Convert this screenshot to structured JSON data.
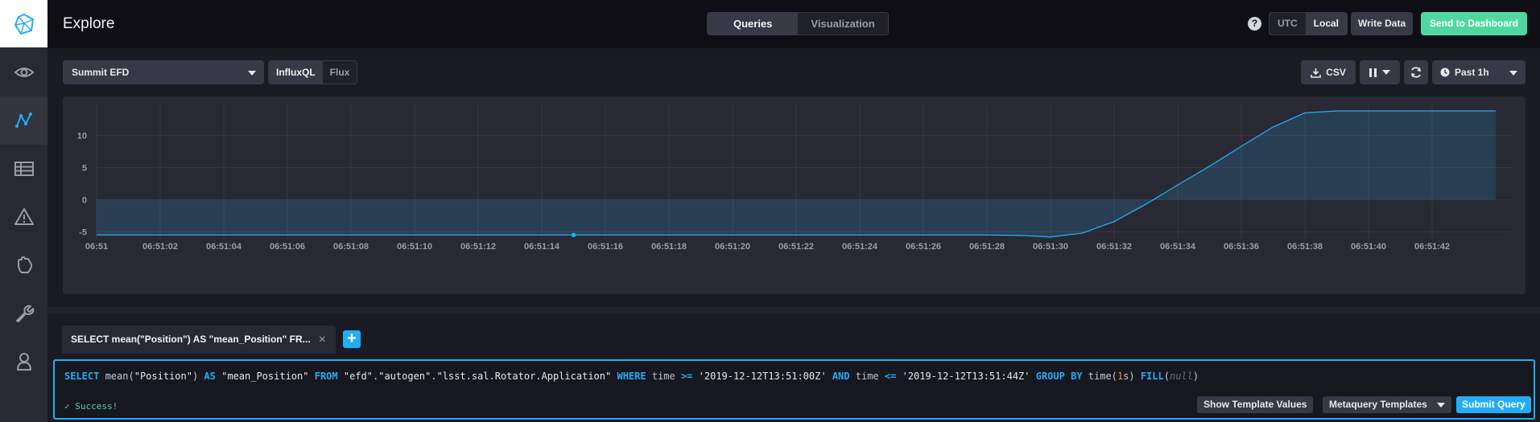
{
  "header": {
    "title": "Explore",
    "mode_tabs": [
      {
        "label": "Queries",
        "active": true
      },
      {
        "label": "Visualization",
        "active": false
      }
    ],
    "help_glyph": "?",
    "timezone": [
      {
        "label": "UTC",
        "active": false
      },
      {
        "label": "Local",
        "active": true
      }
    ],
    "write_data_label": "Write Data",
    "send_dashboard_label": "Send to Dashboard"
  },
  "nav": {
    "items": [
      {
        "icon": "logo-icon"
      },
      {
        "icon": "eye-icon"
      },
      {
        "icon": "graph-icon",
        "active": true
      },
      {
        "icon": "table-icon"
      },
      {
        "icon": "alert-icon"
      },
      {
        "icon": "hand-icon"
      },
      {
        "icon": "wrench-icon"
      },
      {
        "icon": "user-icon"
      }
    ]
  },
  "toolbar": {
    "database": "Summit EFD",
    "languages": [
      {
        "label": "InfluxQL",
        "active": true
      },
      {
        "label": "Flux",
        "active": false
      }
    ],
    "csv_label": "CSV",
    "time_range": "Past 1h"
  },
  "chart_data": {
    "type": "area",
    "title": "",
    "xlabel": "",
    "ylabel": "",
    "x_tick_labels": [
      "06:51",
      "06:51:02",
      "06:51:04",
      "06:51:06",
      "06:51:08",
      "06:51:10",
      "06:51:12",
      "06:51:14",
      "06:51:16",
      "06:51:18",
      "06:51:20",
      "06:51:22",
      "06:51:24",
      "06:51:26",
      "06:51:28",
      "06:51:30",
      "06:51:32",
      "06:51:34",
      "06:51:36",
      "06:51:38",
      "06:51:40",
      "06:51:42"
    ],
    "y_tick_labels": [
      "10",
      "5",
      "0",
      "-5"
    ],
    "y_ticks": [
      10,
      5,
      0,
      -5
    ],
    "ylim": [
      -6.2,
      14.8
    ],
    "xlim": [
      0,
      44
    ],
    "grid": true,
    "series": [
      {
        "x": [
          0,
          5,
          10,
          15,
          20,
          25,
          28,
          29,
          30,
          31,
          32,
          33,
          34,
          35,
          36,
          37,
          38,
          39,
          40,
          41,
          42,
          43,
          44
        ],
        "y": [
          -5.5,
          -5.5,
          -5.5,
          -5.5,
          -5.5,
          -5.5,
          -5.5,
          -5.55,
          -5.8,
          -5.2,
          -3.4,
          -0.7,
          2.3,
          5.2,
          8.3,
          11.3,
          13.5,
          13.8,
          13.8,
          13.8,
          13.8,
          13.8,
          13.8
        ]
      }
    ],
    "highlight_point": {
      "x": 15,
      "y": -5.5
    },
    "color": "#22adf6"
  },
  "query": {
    "tab_label": "SELECT mean(\"Position\") AS \"mean_Position\" FR...",
    "close_glyph": "×",
    "add_glyph": "+",
    "tokens": [
      {
        "t": "SELECT",
        "c": "kw"
      },
      {
        "t": " mean(",
        "c": "fn"
      },
      {
        "t": "\"Position\"",
        "c": "str"
      },
      {
        "t": ") ",
        "c": "fn"
      },
      {
        "t": "AS",
        "c": "kw"
      },
      {
        "t": " ",
        "c": "fn"
      },
      {
        "t": "\"mean_Position\"",
        "c": "str"
      },
      {
        "t": " ",
        "c": "fn"
      },
      {
        "t": "FROM",
        "c": "kw"
      },
      {
        "t": " ",
        "c": "fn"
      },
      {
        "t": "\"efd\"",
        "c": "str"
      },
      {
        "t": ".",
        "c": "fn"
      },
      {
        "t": "\"autogen\"",
        "c": "str"
      },
      {
        "t": ".",
        "c": "fn"
      },
      {
        "t": "\"lsst.sal.Rotator.Application\"",
        "c": "str"
      },
      {
        "t": " ",
        "c": "fn"
      },
      {
        "t": "WHERE",
        "c": "kw"
      },
      {
        "t": " time ",
        "c": "id"
      },
      {
        "t": ">=",
        "c": "kw"
      },
      {
        "t": " ",
        "c": "fn"
      },
      {
        "t": "'2019-12-12T13:51:00Z'",
        "c": "str"
      },
      {
        "t": " ",
        "c": "fn"
      },
      {
        "t": "AND",
        "c": "kw"
      },
      {
        "t": " time ",
        "c": "id"
      },
      {
        "t": "<=",
        "c": "kw"
      },
      {
        "t": " ",
        "c": "fn"
      },
      {
        "t": "'2019-12-12T13:51:44Z'",
        "c": "str"
      },
      {
        "t": " ",
        "c": "fn"
      },
      {
        "t": "GROUP BY",
        "c": "kw"
      },
      {
        "t": " time(",
        "c": "fn"
      },
      {
        "t": "1",
        "c": "num"
      },
      {
        "t": "s",
        "c": "fn"
      },
      {
        "t": ") ",
        "c": "fn"
      },
      {
        "t": "FILL",
        "c": "kw"
      },
      {
        "t": "(",
        "c": "fn"
      },
      {
        "t": "null",
        "c": "nul"
      },
      {
        "t": ")",
        "c": "fn"
      }
    ],
    "status": "Success!",
    "show_templates_label": "Show Template Values",
    "metaquery_label": "Metaquery Templates",
    "submit_label": "Submit Query"
  }
}
